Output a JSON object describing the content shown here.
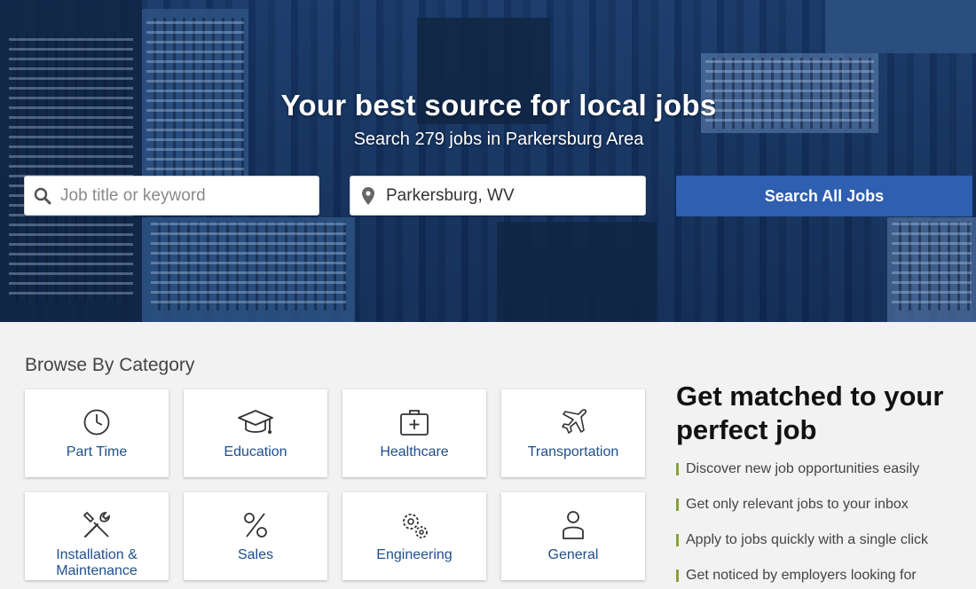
{
  "hero": {
    "title": "Your best source for local jobs",
    "subtitle": "Search 279 jobs in Parkersburg Area",
    "keyword_placeholder": "Job title or keyword",
    "keyword_value": "",
    "location_value": "Parkersburg, WV",
    "search_button": "Search All Jobs",
    "search_icon": "search-icon",
    "location_icon": "map-pin-icon"
  },
  "browse": {
    "title": "Browse By Category",
    "categories": [
      {
        "label": "Part Time",
        "icon": "clock-icon"
      },
      {
        "label": "Education",
        "icon": "graduation-cap-icon"
      },
      {
        "label": "Healthcare",
        "icon": "medical-kit-icon"
      },
      {
        "label": "Transportation",
        "icon": "airplane-icon"
      },
      {
        "label": "Installation & Maintenance",
        "icon": "tools-icon"
      },
      {
        "label": "Sales",
        "icon": "percent-icon"
      },
      {
        "label": "Engineering",
        "icon": "gears-icon"
      },
      {
        "label": "General",
        "icon": "person-icon"
      }
    ]
  },
  "match": {
    "title": "Get matched to your perfect job",
    "benefits": [
      "Discover new job opportunities easily",
      "Get only relevant jobs to your inbox",
      "Apply to jobs quickly with a single click",
      "Get noticed by employers looking for"
    ]
  },
  "colors": {
    "accent": "#2f5fb0",
    "category_text": "#1f4f8a",
    "benefit_bar": "#8aa13a"
  }
}
